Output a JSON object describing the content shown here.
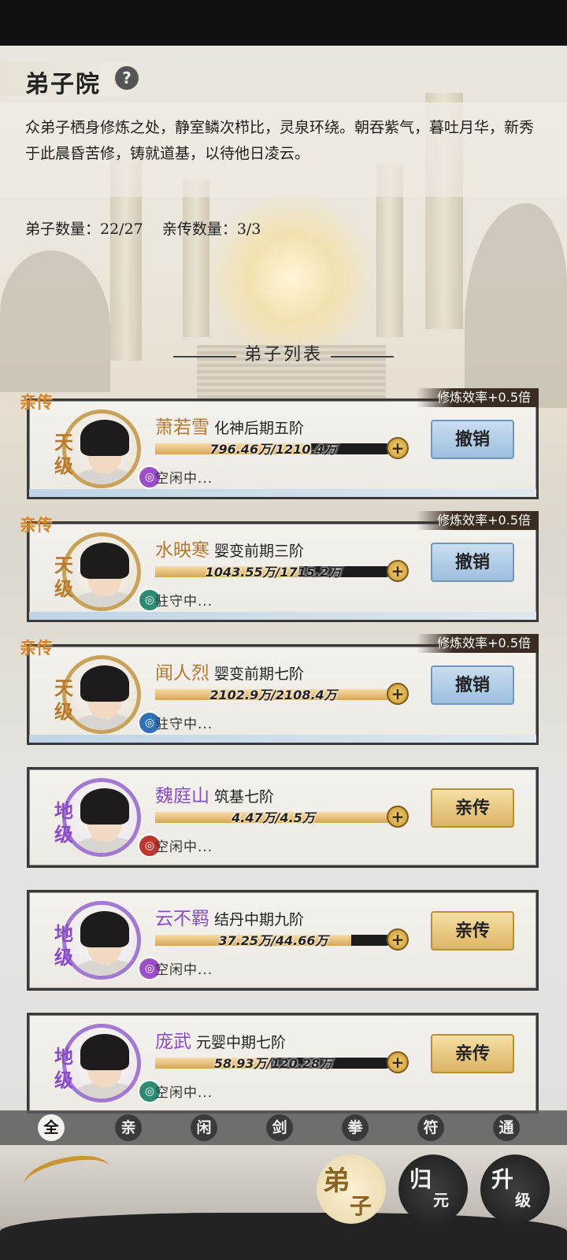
{
  "page": {
    "title": "弟子院",
    "help_icon": "?",
    "description": "众弟子栖身修炼之处，静室鳞次栉比，灵泉环绕。朝吞紫气，暮吐月华，新秀于此晨昏苦修，铸就道基，以待他日凌云。",
    "disciple_count": "弟子数量：22/27",
    "inner_count": "亲传数量：3/3",
    "list_title": "弟子列表"
  },
  "disciples": [
    {
      "tag": "亲传",
      "efficiency": "修炼效率+0.5倍",
      "name": "萧若雪",
      "realm": "化神后期五阶",
      "grade": "天级",
      "exp_text": "796.46万/1210.4万",
      "exp_progress": 0.66,
      "status": "空闲中...",
      "action": "撤销",
      "element_icon": "water-swirl-icon",
      "element_color": "#9b4fc9"
    },
    {
      "tag": "亲传",
      "efficiency": "修炼效率+0.5倍",
      "name": "水映寒",
      "realm": "婴变前期三阶",
      "grade": "天级",
      "exp_text": "1043.55万/1715.2万",
      "exp_progress": 0.61,
      "status": "驻守中...",
      "action": "撤销",
      "element_icon": "wind-swirl-icon",
      "element_color": "#2d8a73"
    },
    {
      "tag": "亲传",
      "efficiency": "修炼效率+0.5倍",
      "name": "闻人烈",
      "realm": "婴变前期七阶",
      "grade": "天级",
      "exp_text": "2102.9万/2108.4万",
      "exp_progress": 0.997,
      "status": "驻守中...",
      "action": "撤销",
      "element_icon": "sword-icon",
      "element_color": "#2f72b8"
    },
    {
      "tag": "",
      "efficiency": "",
      "name": "魏庭山",
      "realm": "筑基七阶",
      "grade": "地级",
      "exp_text": "4.47万/4.5万",
      "exp_progress": 0.993,
      "status": "空闲中...",
      "action": "亲传",
      "element_icon": "fist-icon",
      "element_color": "#c0352e"
    },
    {
      "tag": "",
      "efficiency": "",
      "name": "云不羁",
      "realm": "结丹中期九阶",
      "grade": "地级",
      "exp_text": "37.25万/44.66万",
      "exp_progress": 0.83,
      "status": "空闲中...",
      "action": "亲传",
      "element_icon": "water-swirl-icon",
      "element_color": "#9b4fc9"
    },
    {
      "tag": "",
      "efficiency": "",
      "name": "庞武",
      "realm": "元婴中期七阶",
      "grade": "地级",
      "exp_text": "58.93万/120.28万",
      "exp_progress": 0.49,
      "status": "空闲中...",
      "action": "亲传",
      "element_icon": "wind-swirl-icon",
      "element_color": "#2d8a73"
    }
  ],
  "filters": [
    "全",
    "亲",
    "闲",
    "剑",
    "拳",
    "符",
    "通"
  ],
  "active_filter": "全",
  "bottom_nav": [
    {
      "top": "弟",
      "bottom": "子"
    },
    {
      "top": "归",
      "bottom": "元"
    },
    {
      "top": "升",
      "bottom": "级"
    }
  ]
}
